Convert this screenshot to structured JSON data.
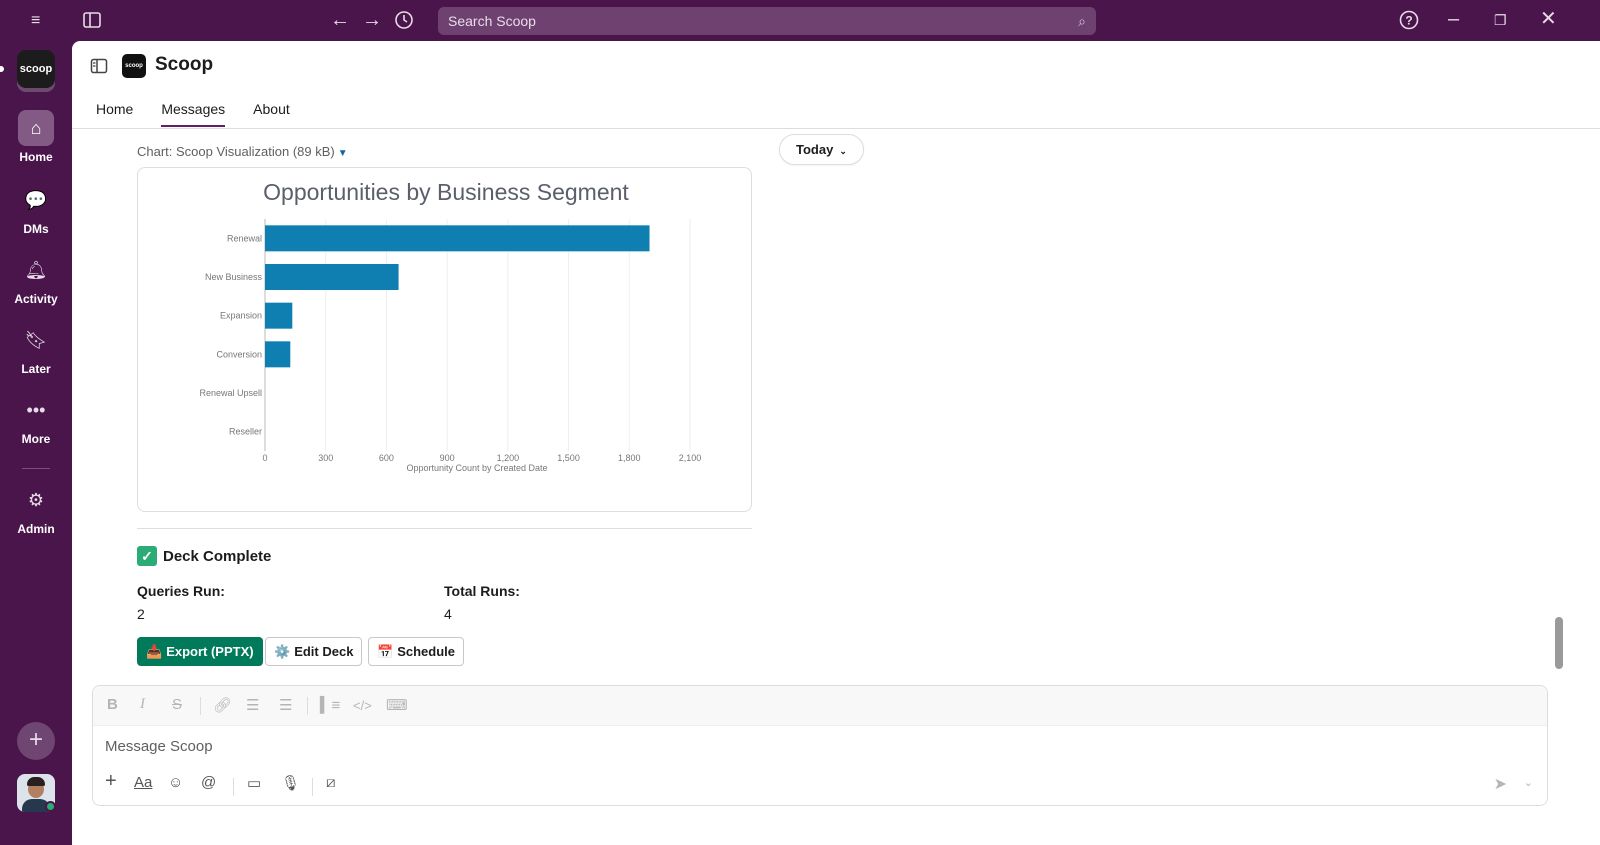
{
  "titlebar": {
    "search_placeholder": "Search Scoop",
    "icons": [
      "menu-icon",
      "sidebar-toggle-icon",
      "back-arrow-icon",
      "forward-arrow-icon",
      "history-icon",
      "help-icon",
      "minimize-icon",
      "restore-icon",
      "close-icon"
    ]
  },
  "workspace": {
    "logo_text": "scoop"
  },
  "rail": {
    "items": [
      {
        "label": "Home",
        "icon": "home-icon"
      },
      {
        "label": "DMs",
        "icon": "dms-icon"
      },
      {
        "label": "Activity",
        "icon": "bell-icon"
      },
      {
        "label": "Later",
        "icon": "bookmark-icon"
      },
      {
        "label": "More",
        "icon": "ellipsis-icon"
      },
      {
        "label": "Admin",
        "icon": "gear-icon"
      }
    ]
  },
  "header": {
    "app_logo_text": "scoop",
    "app_name": "Scoop",
    "tabs": [
      {
        "label": "Home",
        "active": false
      },
      {
        "label": "Messages",
        "active": true
      },
      {
        "label": "About",
        "active": false
      }
    ]
  },
  "message": {
    "file_label": "Chart: Scoop Visualization (89 kB)",
    "date_pill": "Today",
    "deck_title": "Deck Complete",
    "queries_run_label": "Queries Run:",
    "queries_run_value": "2",
    "total_runs_label": "Total Runs:",
    "total_runs_value": "4",
    "buttons": {
      "export": "Export (PPTX)",
      "edit": "Edit Deck",
      "schedule": "Schedule"
    }
  },
  "chart_data": {
    "type": "bar",
    "orientation": "horizontal",
    "title": "Opportunities by Business Segment",
    "xlabel": "Opportunity Count by Created Date",
    "ylabel": "",
    "categories": [
      "Renewal",
      "New Business",
      "Expansion",
      "Conversion",
      "Renewal Upsell",
      "Reseller"
    ],
    "values": [
      1900,
      660,
      135,
      125,
      0,
      0
    ],
    "xlim": [
      0,
      2100
    ],
    "xticks": [
      "0",
      "300",
      "600",
      "900",
      "1,200",
      "1,500",
      "1,800",
      "2,100"
    ],
    "bar_color": "#0e7fb0",
    "grid": true
  },
  "composer": {
    "placeholder": "Message Scoop",
    "format_icons": [
      "bold-icon",
      "italic-icon",
      "strikethrough-icon",
      "link-icon",
      "ordered-list-icon",
      "bullet-list-icon",
      "blockquote-icon",
      "code-icon",
      "code-block-icon"
    ],
    "tool_icons": [
      "plus-icon",
      "text-format-icon",
      "emoji-icon",
      "mention-icon",
      "video-icon",
      "microphone-icon",
      "slash-command-icon"
    ]
  },
  "colors": {
    "aubergine": "#4a154b",
    "primary_button": "#007a5a",
    "tab_underline": "#611f69"
  }
}
